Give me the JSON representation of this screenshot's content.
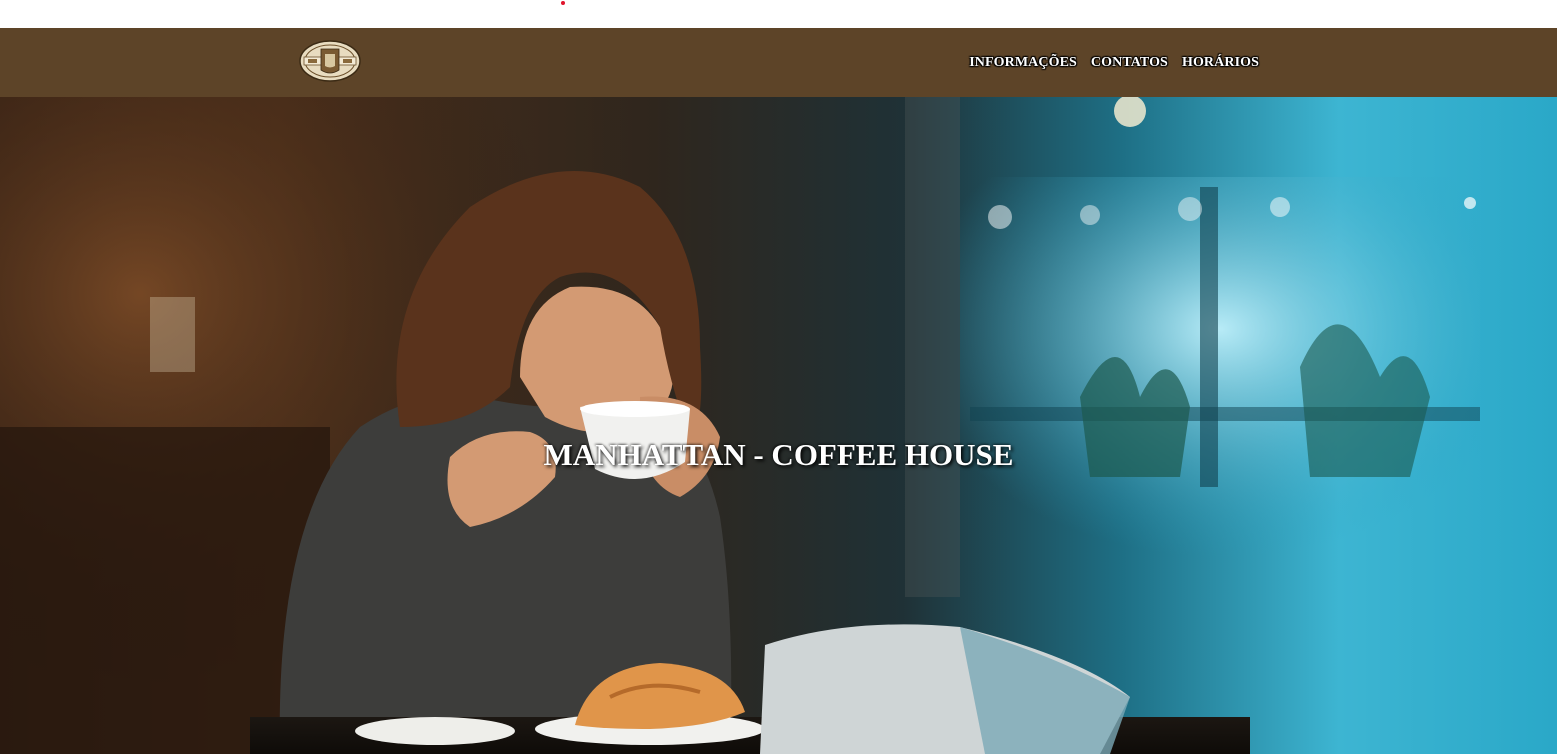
{
  "header": {
    "logo": {
      "icon": "coffee-house-emblem"
    },
    "nav": [
      {
        "label": "INFORMAÇÕES"
      },
      {
        "label": "CONTATOS"
      },
      {
        "label": "HORÁRIOS"
      }
    ]
  },
  "hero": {
    "title": "MANHATTAN - COFFEE HOUSE",
    "image": "woman-drinking-coffee-photo"
  },
  "colors": {
    "navbar": "#5d4428",
    "accent_dot": "#e0142c",
    "text": "#ffffff"
  }
}
